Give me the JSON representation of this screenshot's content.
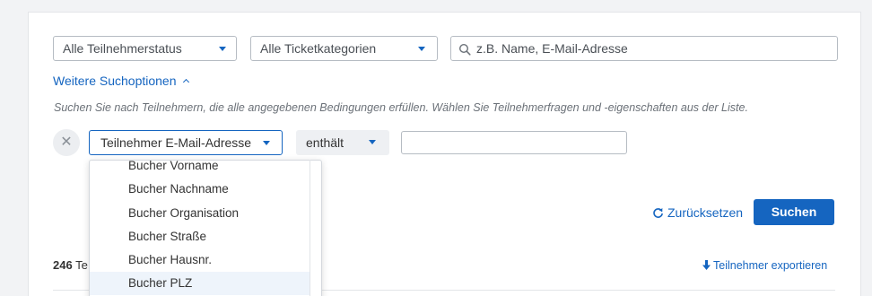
{
  "filters": {
    "status_select": "Alle Teilnehmerstatus",
    "ticket_select": "Alle Ticketkategorien",
    "search_placeholder": "z.B. Name, E-Mail-Adresse"
  },
  "more_options": {
    "label": "Weitere Suchoptionen",
    "hint": "Suchen Sie nach Teilnehmern, die alle angegebenen Bedingungen erfüllen. Wählen Sie Teilnehmerfragen und -eigenschaften aus der Liste."
  },
  "condition": {
    "remove_glyph": "✕",
    "field": "Teilnehmer E-Mail-Adresse",
    "operator": "enthält",
    "value": ""
  },
  "dropdown": {
    "items": [
      {
        "label": "Bucher Vorname"
      },
      {
        "label": "Bucher Nachname"
      },
      {
        "label": "Bucher Organisation"
      },
      {
        "label": "Bucher Straße"
      },
      {
        "label": "Bucher Hausnr."
      },
      {
        "label": "Bucher PLZ"
      }
    ],
    "highlighted_index": 5
  },
  "actions": {
    "reset_label": "Zurücksetzen",
    "search_label": "Suchen"
  },
  "results": {
    "count": "246",
    "count_suffix": "Te",
    "export_label": "Teilnehmer exportieren"
  },
  "colors": {
    "accent": "#1565c0",
    "panel_bg": "#ffffff",
    "page_bg": "#f2f3f5",
    "highlight_bg": "#eef4fb"
  },
  "icons": {
    "select_caret": "caret-down-icon",
    "search": "search-icon",
    "more_options": "chevron-up-icon",
    "remove": "close-icon",
    "reset": "refresh-icon",
    "export": "download-arrow-icon"
  }
}
